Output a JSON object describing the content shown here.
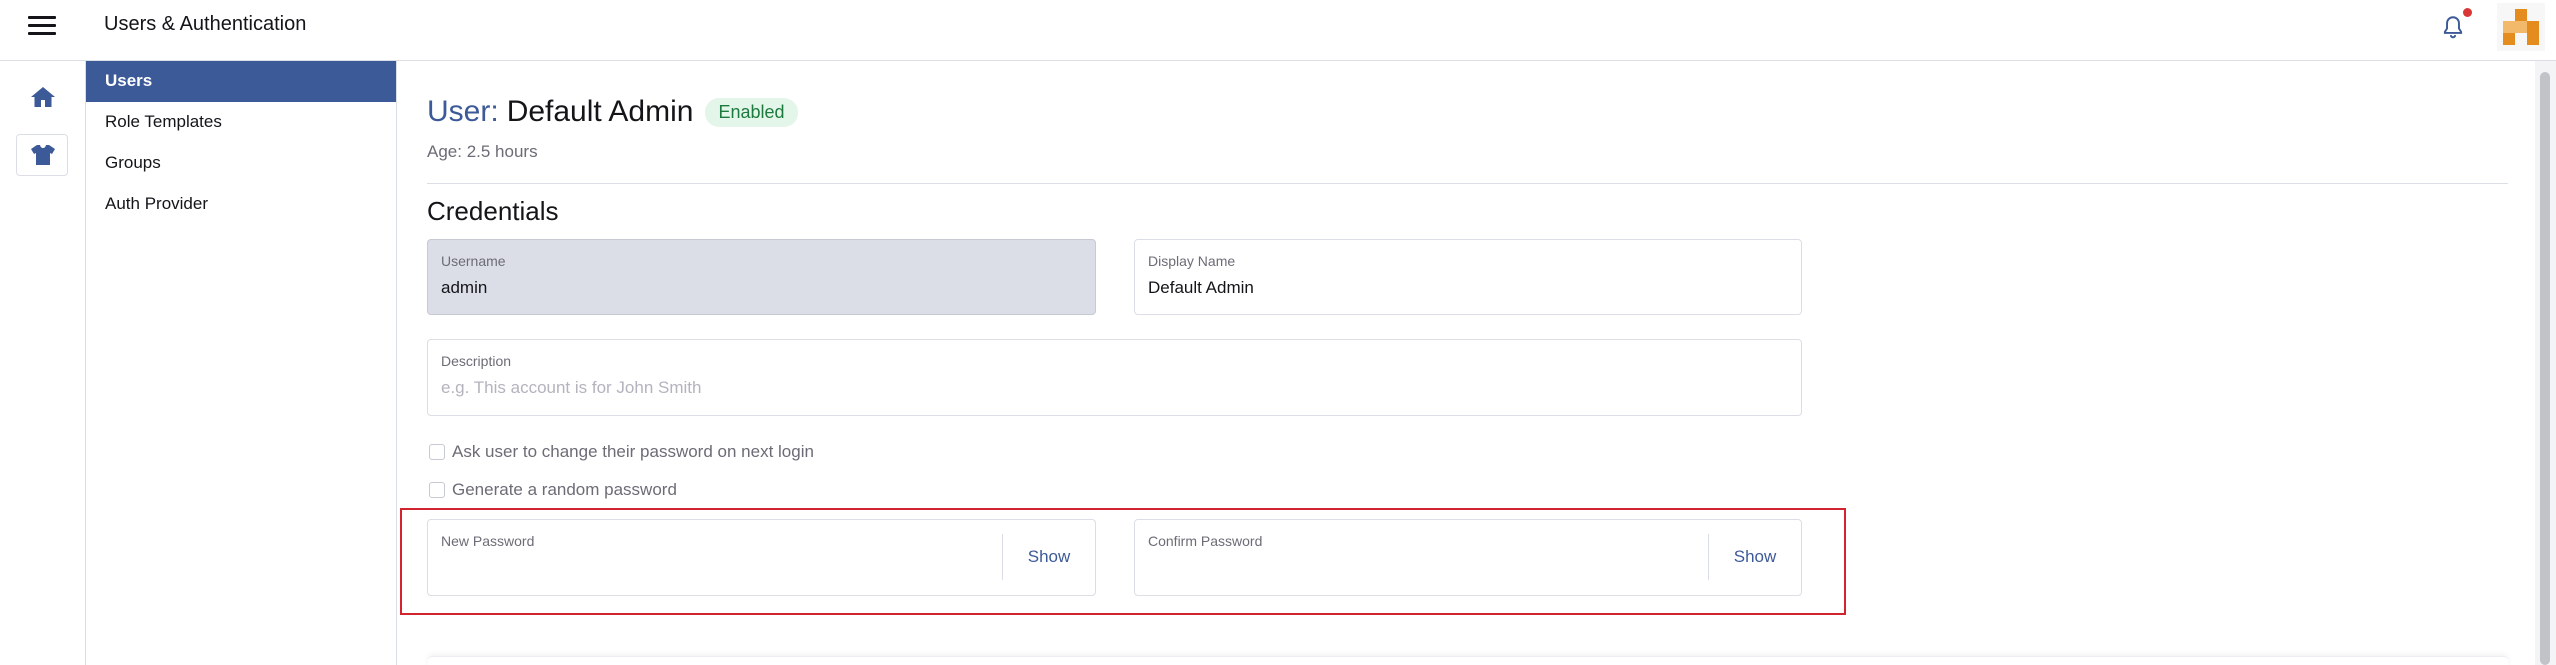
{
  "header": {
    "title": "Users & Authentication",
    "notification_icon": "bell-icon",
    "notification_dot_color": "#d93636",
    "menu_icon": "hamburger-menu-icon"
  },
  "rail": {
    "home_icon": "home-icon",
    "cluster_icon": "cluster-shirt-icon",
    "accent": "#3d5a98"
  },
  "sidenav": {
    "items": [
      {
        "label": "Users",
        "active": true
      },
      {
        "label": "Role Templates",
        "active": false
      },
      {
        "label": "Groups",
        "active": false
      },
      {
        "label": "Auth Provider",
        "active": false
      }
    ]
  },
  "page": {
    "title_prefix": "User:",
    "title_name": "Default Admin",
    "status_badge": "Enabled",
    "age": "Age: 2.5 hours",
    "section_title": "Credentials"
  },
  "form": {
    "username": {
      "label": "Username",
      "value": "admin",
      "disabled": true
    },
    "display_name": {
      "label": "Display Name",
      "value": "Default Admin"
    },
    "description": {
      "label": "Description",
      "placeholder": "e.g. This account is for John Smith"
    },
    "change_password_checkbox": {
      "label": "Ask user to change their password on next login",
      "checked": false
    },
    "random_password_checkbox": {
      "label": "Generate a random password",
      "checked": false
    },
    "new_password": {
      "label": "New Password",
      "value": "",
      "show_label": "Show"
    },
    "confirm_password": {
      "label": "Confirm Password",
      "value": "",
      "show_label": "Show"
    }
  },
  "colors": {
    "brand": "#3d5a98",
    "badge_bg": "#e4f6ea",
    "badge_text": "#1d7a3e",
    "highlight": "#d1242f"
  }
}
